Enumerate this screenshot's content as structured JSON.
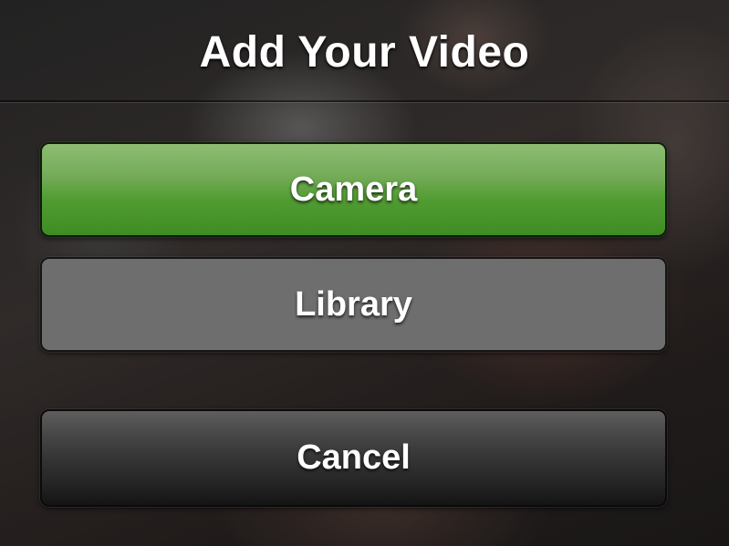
{
  "sheet": {
    "title": "Add Your Video",
    "buttons": {
      "camera": "Camera",
      "library": "Library",
      "cancel": "Cancel"
    }
  },
  "colors": {
    "camera_button": "#529d33",
    "library_button": "#6e6e6e",
    "cancel_button": "#262626",
    "text": "#ffffff"
  }
}
